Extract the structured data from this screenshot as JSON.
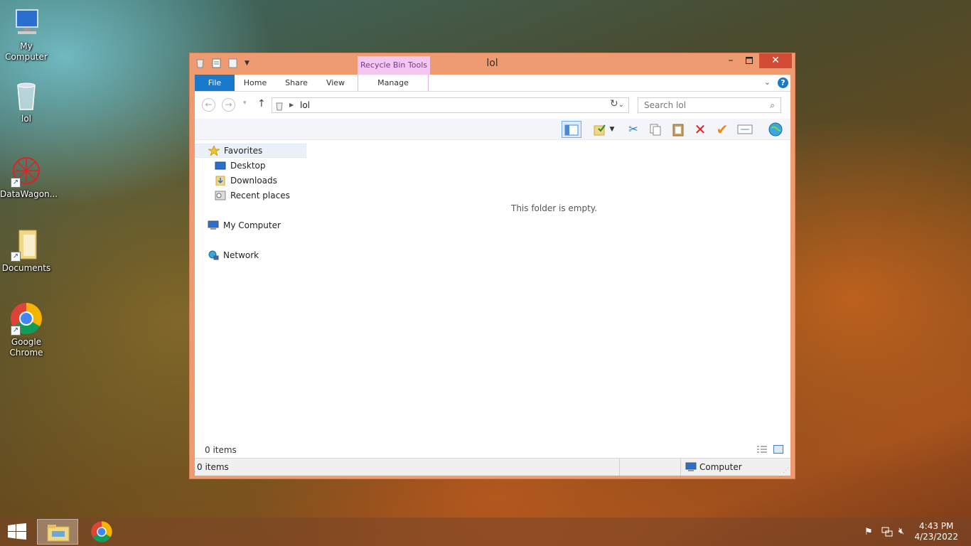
{
  "desktop": {
    "icons": [
      {
        "label": "My\nComputer",
        "name": "my-computer"
      },
      {
        "label": "lol",
        "name": "recycle-bin"
      },
      {
        "label": "DataWagon...",
        "name": "datawagon"
      },
      {
        "label": "Documents",
        "name": "documents"
      },
      {
        "label": "Google\nChrome",
        "name": "google-chrome"
      }
    ]
  },
  "window": {
    "title": "lol",
    "context_tab": "Recycle Bin Tools",
    "tabs": {
      "file": "File",
      "home": "Home",
      "share": "Share",
      "view": "View",
      "manage": "Manage"
    },
    "address": {
      "path": "lol"
    },
    "search": {
      "placeholder": "Search lol"
    },
    "nav": {
      "favorites": "Favorites",
      "desktop": "Desktop",
      "downloads": "Downloads",
      "recent": "Recent places",
      "computer": "My Computer",
      "network": "Network"
    },
    "empty_message": "This folder is empty.",
    "item_count": "0 items",
    "status": {
      "left": "0 items",
      "right": "Computer"
    }
  },
  "taskbar": {
    "time": "4:43 PM",
    "date": "4/23/2022"
  }
}
